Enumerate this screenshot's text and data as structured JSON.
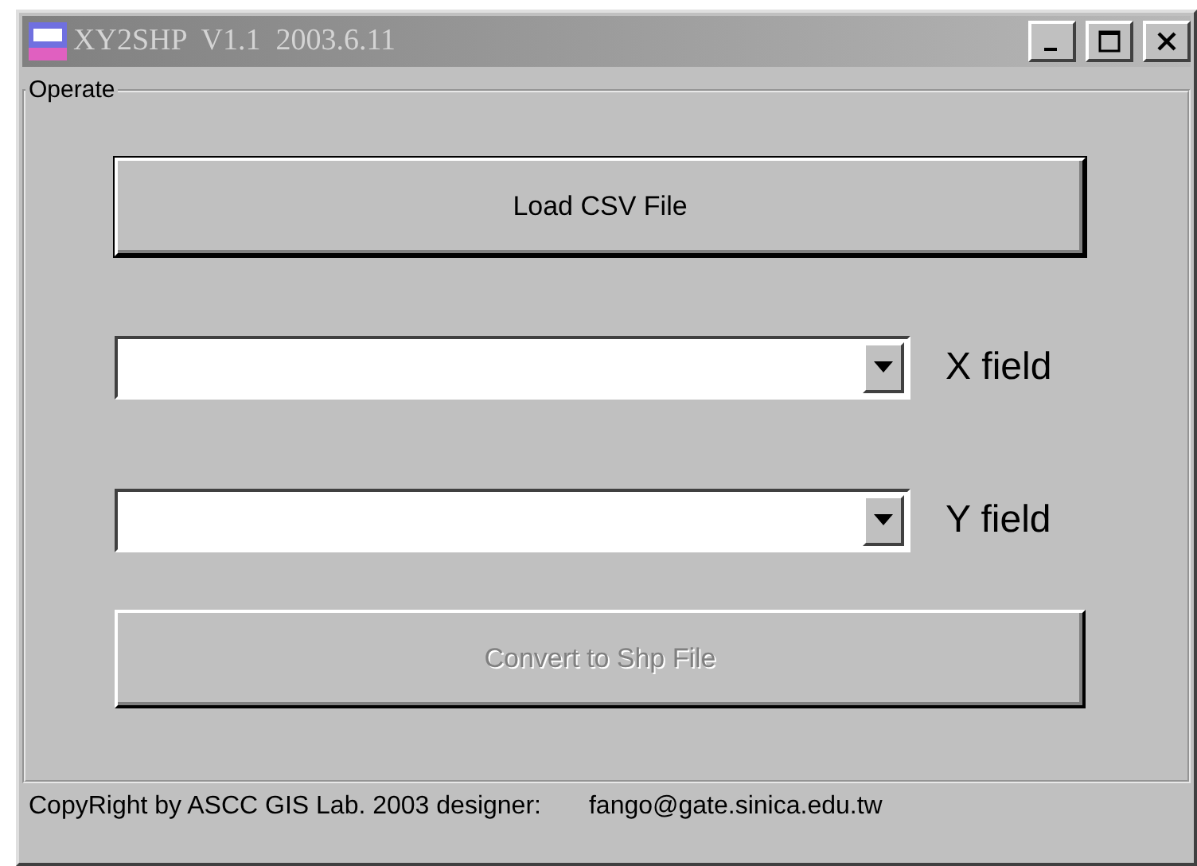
{
  "window": {
    "title": "XY2SHP  V1.1  2003.6.11",
    "active": false
  },
  "group": {
    "label": "Operate"
  },
  "load_button": {
    "label": "Load CSV File",
    "disabled": false
  },
  "combos": [
    {
      "label": "X field"
    },
    {
      "label": "Y field"
    }
  ],
  "convert_button": {
    "label": "Convert to Shp File",
    "disabled": true
  },
  "status_bar": {
    "copyright": "CopyRight by ASCC GIS Lab. 2003 designer:",
    "email": "fango@gate.sinica.edu.tw"
  }
}
